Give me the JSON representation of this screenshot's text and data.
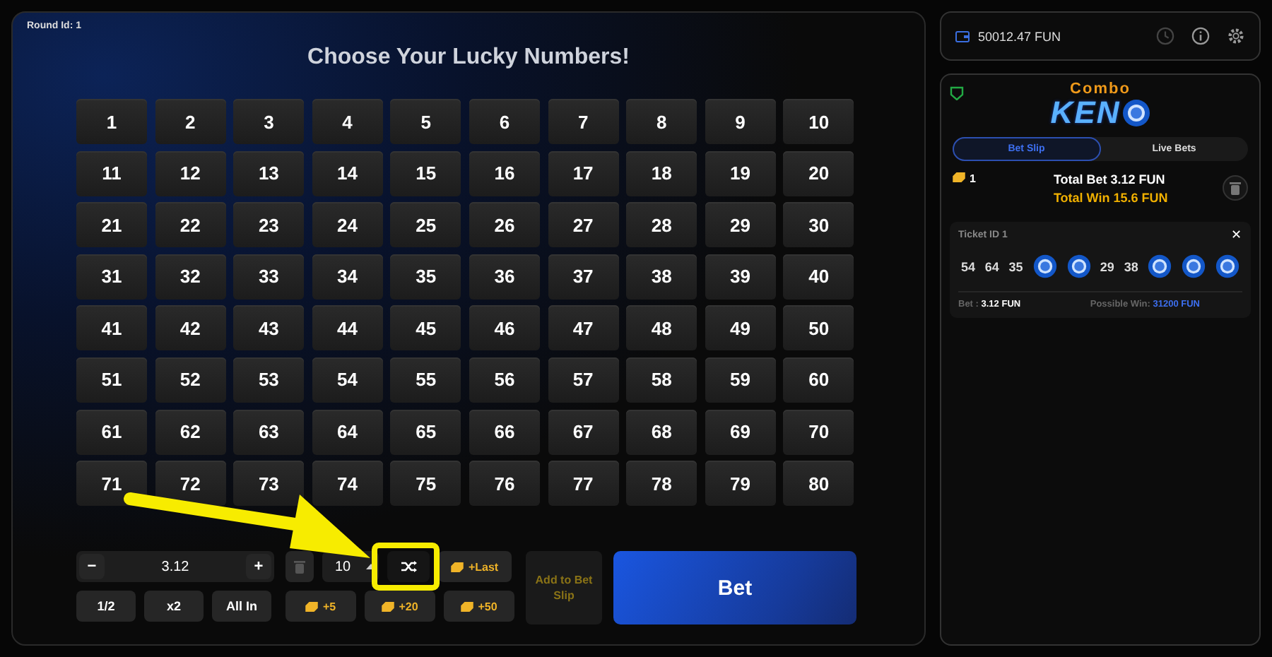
{
  "round_id": "Round Id: 1",
  "title": "Choose Your Lucky Numbers!",
  "numbers": [
    "1",
    "2",
    "3",
    "4",
    "5",
    "6",
    "7",
    "8",
    "9",
    "10",
    "11",
    "12",
    "13",
    "14",
    "15",
    "16",
    "17",
    "18",
    "19",
    "20",
    "21",
    "22",
    "23",
    "24",
    "25",
    "26",
    "27",
    "28",
    "29",
    "30",
    "31",
    "32",
    "33",
    "34",
    "35",
    "36",
    "37",
    "38",
    "39",
    "40",
    "41",
    "42",
    "43",
    "44",
    "45",
    "46",
    "47",
    "48",
    "49",
    "50",
    "51",
    "52",
    "53",
    "54",
    "55",
    "56",
    "57",
    "58",
    "59",
    "60",
    "61",
    "62",
    "63",
    "64",
    "65",
    "66",
    "67",
    "68",
    "69",
    "70",
    "71",
    "72",
    "73",
    "74",
    "75",
    "76",
    "77",
    "78",
    "79",
    "80"
  ],
  "bet_amount": {
    "value": "3.12",
    "minus": "−",
    "plus": "+"
  },
  "amount_buttons": [
    "1/2",
    "x2",
    "All In"
  ],
  "pick_count": "10",
  "ticket_buttons": [
    {
      "label": "+Last"
    },
    {
      "label": "+5"
    },
    {
      "label": "+20"
    },
    {
      "label": "+50"
    }
  ],
  "add_to_slip": "Add to Bet Slip",
  "bet_button": "Bet",
  "balance": "50012.47 FUN",
  "logo": {
    "top": "Combo",
    "main": "KEN"
  },
  "tabs": [
    {
      "label": "Bet Slip",
      "selected": true
    },
    {
      "label": "Live Bets",
      "selected": false
    }
  ],
  "slip": {
    "count": "1",
    "total_bet": "Total Bet 3.12 FUN",
    "total_win": "Total Win 15.6 FUN"
  },
  "ticket": {
    "title": "Ticket ID 1",
    "close": "✕",
    "numbers": [
      {
        "kind": "number",
        "label": "54"
      },
      {
        "kind": "number",
        "label": "64"
      },
      {
        "kind": "number",
        "label": "35"
      },
      {
        "kind": "ball"
      },
      {
        "kind": "ball"
      },
      {
        "kind": "number",
        "label": "29"
      },
      {
        "kind": "number",
        "label": "38"
      },
      {
        "kind": "ball"
      },
      {
        "kind": "ball"
      },
      {
        "kind": "ball"
      }
    ],
    "bet_label": "Bet :",
    "bet": "3.12 FUN",
    "win_label": "Possible Win:",
    "win": "31200 FUN"
  }
}
